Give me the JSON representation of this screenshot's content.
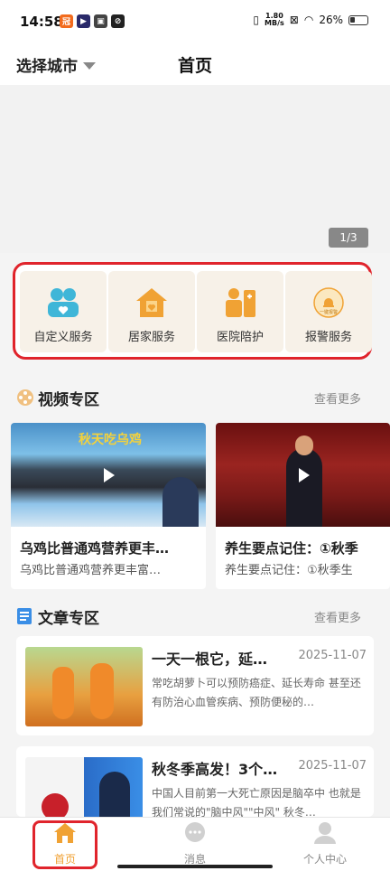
{
  "status_bar": {
    "time": "14:58",
    "net_speed_value": "1.80",
    "net_speed_unit": "MB/s",
    "battery": "26%"
  },
  "header": {
    "city_select": "选择城市",
    "title": "首页"
  },
  "banner": {
    "indicator": "1/3"
  },
  "services": {
    "items": [
      {
        "label": "自定义服务",
        "icon": "people-heart-icon"
      },
      {
        "label": "居家服务",
        "icon": "home-heart-icon"
      },
      {
        "label": "医院陪护",
        "icon": "nurse-icon"
      },
      {
        "label": "报警服务",
        "icon": "alarm-icon",
        "icon_text": "一键报警"
      }
    ]
  },
  "video_section": {
    "title": "视频专区",
    "more": "查看更多",
    "videos": [
      {
        "title": "乌鸡比普通鸡营养更丰…",
        "desc": "乌鸡比普通鸡营养更丰富…",
        "thumb_text": "秋天吃乌鸡"
      },
      {
        "title": "养生要点记住：①秋季",
        "desc": "养生要点记住：①秋季生"
      }
    ]
  },
  "article_section": {
    "title": "文章专区",
    "more": "查看更多",
    "articles": [
      {
        "title": "一天一根它，延…",
        "date": "2025-11-07",
        "summary": "常吃胡萝卜可以预防癌症、延长寿命 甚至还有防治心血管疾病、预防便秘的…"
      },
      {
        "title": "秋冬季高发！3个…",
        "date": "2025-11-07",
        "summary": "中国人目前第一大死亡原因是脑卒中 也就是我们常说的\"脑中风\"\"中风\" 秋冬…"
      }
    ]
  },
  "tabbar": {
    "tabs": [
      {
        "label": "首页",
        "active": true
      },
      {
        "label": "消息",
        "active": false
      },
      {
        "label": "个人中心",
        "active": false
      }
    ]
  },
  "colors": {
    "accent": "#f0a234",
    "highlight_border": "#e0242c",
    "service_bg": "#f7f1e8"
  }
}
